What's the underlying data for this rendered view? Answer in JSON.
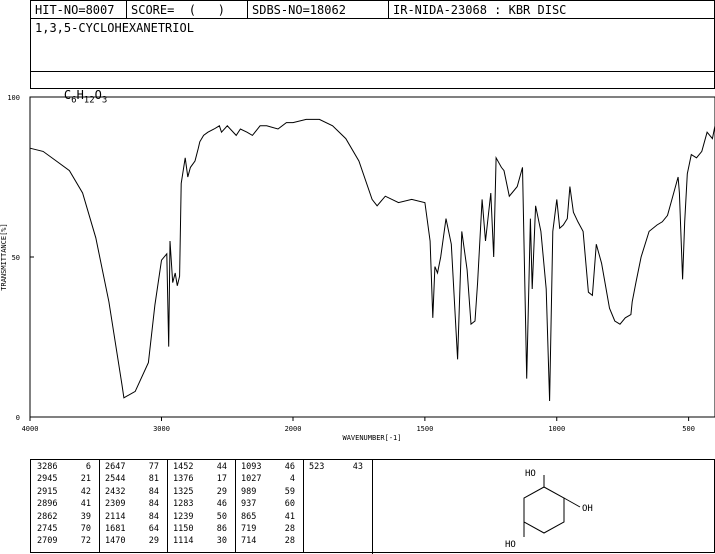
{
  "header": {
    "hit_no": "HIT-NO=8007",
    "score": "SCORE=  (   )",
    "sdbs_no": "SDBS-NO=18062",
    "ir_info": "IR-NIDA-23068 : KBR DISC"
  },
  "compound": {
    "name": "1,3,5-CYCLOHEXANETRIOL",
    "formula_c": "C",
    "formula_c_n": "6",
    "formula_h": "H",
    "formula_h_n": "12",
    "formula_o": "O",
    "formula_o_n": "3"
  },
  "chart_data": {
    "type": "line",
    "xlabel": "WAVENUMBER[-1]",
    "ylabel": "TRANSMITTANCE[%]",
    "xlim": [
      4000,
      400
    ],
    "ylim": [
      0,
      100
    ],
    "x_ticks": [
      "4000",
      "3000",
      "2000",
      "1500",
      "1000",
      "500"
    ],
    "y_ticks": [
      "100",
      "50",
      "0"
    ],
    "x": [
      4000,
      3900,
      3800,
      3700,
      3600,
      3500,
      3400,
      3300,
      3286,
      3200,
      3100,
      3050,
      3000,
      2960,
      2945,
      2935,
      2915,
      2896,
      2880,
      2862,
      2850,
      2820,
      2800,
      2780,
      2745,
      2720,
      2709,
      2680,
      2647,
      2600,
      2560,
      2544,
      2500,
      2432,
      2400,
      2350,
      2309,
      2250,
      2200,
      2114,
      2050,
      2000,
      1950,
      1900,
      1850,
      1800,
      1750,
      1700,
      1681,
      1650,
      1600,
      1550,
      1500,
      1480,
      1470,
      1462,
      1452,
      1440,
      1420,
      1400,
      1376,
      1360,
      1340,
      1325,
      1310,
      1300,
      1283,
      1270,
      1250,
      1239,
      1230,
      1210,
      1200,
      1180,
      1150,
      1130,
      1114,
      1100,
      1093,
      1080,
      1060,
      1040,
      1027,
      1015,
      1000,
      989,
      975,
      960,
      950,
      937,
      920,
      900,
      880,
      865,
      850,
      830,
      800,
      780,
      760,
      740,
      719,
      714,
      700,
      680,
      650,
      620,
      600,
      580,
      560,
      540,
      535,
      523,
      515,
      505,
      490,
      470,
      450,
      430,
      410,
      400
    ],
    "y": [
      84,
      83,
      80,
      77,
      70,
      56,
      36,
      10,
      6,
      8,
      17,
      35,
      49,
      51,
      22,
      55,
      42,
      45,
      41,
      44,
      73,
      81,
      75,
      78,
      80,
      84,
      86,
      88,
      89,
      90,
      91,
      89,
      91,
      88,
      90,
      89,
      88,
      91,
      91,
      90,
      92,
      92,
      93,
      93,
      91,
      87,
      80,
      68,
      66,
      69,
      67,
      68,
      67,
      55,
      31,
      47,
      45,
      50,
      62,
      54,
      18,
      58,
      46,
      29,
      30,
      42,
      68,
      55,
      70,
      50,
      81,
      78,
      77,
      69,
      72,
      78,
      12,
      62,
      40,
      66,
      58,
      40,
      5,
      58,
      68,
      59,
      60,
      62,
      72,
      64,
      61,
      58,
      39,
      38,
      54,
      48,
      34,
      30,
      29,
      31,
      32,
      36,
      42,
      50,
      58,
      60,
      61,
      63,
      69,
      75,
      70,
      43,
      61,
      76,
      82,
      81,
      83,
      89,
      87,
      91
    ],
    "peaks": [
      [
        "3286",
        "6"
      ],
      [
        "2945",
        "21"
      ],
      [
        "2915",
        "42"
      ],
      [
        "2896",
        "41"
      ],
      [
        "2862",
        "39"
      ],
      [
        "2745",
        "70"
      ],
      [
        "2709",
        "72"
      ],
      [
        "2647",
        "77"
      ],
      [
        "2544",
        "81"
      ],
      [
        "2432",
        "84"
      ],
      [
        "2309",
        "84"
      ],
      [
        "2114",
        "84"
      ],
      [
        "1681",
        "64"
      ],
      [
        "1470",
        "29"
      ],
      [
        "1452",
        "44"
      ],
      [
        "1376",
        "17"
      ],
      [
        "1325",
        "29"
      ],
      [
        "1283",
        "46"
      ],
      [
        "1239",
        "50"
      ],
      [
        "1150",
        "86"
      ],
      [
        "1114",
        "30"
      ],
      [
        "1093",
        "46"
      ],
      [
        "1027",
        "4"
      ],
      [
        "989",
        "59"
      ],
      [
        "937",
        "60"
      ],
      [
        "865",
        "41"
      ],
      [
        "719",
        "28"
      ],
      [
        "714",
        "28"
      ],
      [
        "523",
        "43"
      ]
    ]
  },
  "structure": {
    "label_oh_top": "HO",
    "label_oh_right": "OH",
    "label_oh_bottom": "HO"
  }
}
